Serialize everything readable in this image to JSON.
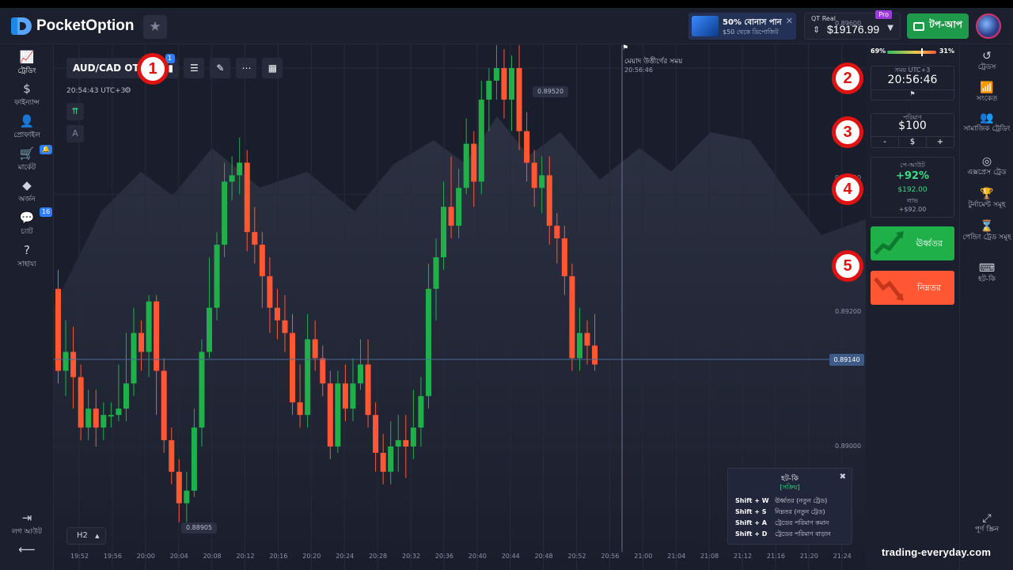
{
  "app": {
    "logo_text": "PocketOption"
  },
  "promo": {
    "line1": "50% বোনাস পান",
    "line2": "$50 থেকে ডিপোজিট"
  },
  "account": {
    "type_label": "QT Real",
    "pro_badge": "Pro",
    "balance": "$19176.99"
  },
  "topup_label": "টপ-আপ",
  "left_nav": [
    {
      "label": "ট্রেডিং",
      "icon": "chart-line-icon",
      "glyph": "📈"
    },
    {
      "label": "ফাইন্যান্স",
      "icon": "dollar-icon",
      "glyph": "$"
    },
    {
      "label": "প্রোফাইল",
      "icon": "user-icon",
      "glyph": "👤"
    },
    {
      "label": "মার্কেট",
      "icon": "cart-icon",
      "glyph": "🛒",
      "badge": "🔔"
    },
    {
      "label": "অর্জন",
      "icon": "diamond-icon",
      "glyph": "◆"
    },
    {
      "label": "চ্যাট",
      "icon": "chat-icon",
      "glyph": "💬",
      "badge": "16"
    },
    {
      "label": "সাহায্য",
      "icon": "help-icon",
      "glyph": "?"
    }
  ],
  "logout_label": "লগ আউট",
  "right_nav": [
    {
      "label": "ট্রেডস",
      "icon": "history-icon",
      "glyph": "↺"
    },
    {
      "label": "সংকেত",
      "icon": "signal-icon",
      "glyph": "📶"
    },
    {
      "label": "সামাজিক ট্রেডিং",
      "icon": "users-icon",
      "glyph": "👥"
    },
    {
      "label": "এক্সপ্রেস ট্রেড",
      "icon": "target-icon",
      "glyph": "◎"
    },
    {
      "label": "টুর্নামেন্ট সমূহ",
      "icon": "trophy-icon",
      "glyph": "🏆"
    },
    {
      "label": "পেন্ডিং ট্রেড সমূহ",
      "icon": "hourglass-icon",
      "glyph": "⌛"
    },
    {
      "label": "হট-কি",
      "icon": "keyboard-icon",
      "glyph": "⌨"
    }
  ],
  "fullscreen_label": "পূর্ণ স্ক্রিন",
  "toolbar": {
    "asset": "AUD/CAD OTC",
    "badge": "1",
    "timeframe": "H2"
  },
  "chart_meta": {
    "clock": "20:54:43 UTC+3",
    "expire_label": "মেয়াদ উত্তীর্ণের সময়",
    "expire_time": "20:56:46",
    "high_label": "0.89520",
    "low_label": "0.88905",
    "current_price": "0.89140",
    "y_axis": [
      "0.89600",
      "0.89400",
      "0.89200",
      "0.89000"
    ],
    "x_axis": [
      "19:52",
      "19:56",
      "20:00",
      "20:04",
      "20:08",
      "20:12",
      "20:16",
      "20:20",
      "20:24",
      "20:28",
      "20:32",
      "20:36",
      "20:40",
      "20:44",
      "20:48",
      "20:52",
      "20:56",
      "21:00",
      "21:04",
      "21:08",
      "21:12",
      "21:16",
      "21:20",
      "21:24"
    ]
  },
  "trade_panel": {
    "sentiment_left": "69%",
    "sentiment_right": "31%",
    "time_caption": "সময় UTC+3",
    "time_value": "20:56:46",
    "amount_caption": "পরিমাণ",
    "amount_value": "$100",
    "minus": "-",
    "currency": "$",
    "plus": "+",
    "payout_caption": "পে-আউট",
    "payout_pct": "+92%",
    "payout_amount": "$192.00",
    "profit_label": "লাভ",
    "profit_value": "+$92.00",
    "up_label": "ঊর্ধ্বতর",
    "down_label": "নিম্নতর"
  },
  "hotkeys": {
    "title": "হট-কি",
    "status": "[সক্রিয়]",
    "rows": [
      {
        "keys": "Shift + W",
        "action": "ঊর্ধ্বতর (নতুন ট্রেড)"
      },
      {
        "keys": "Shift + S",
        "action": "নিম্নতর (নতুন ট্রেড)"
      },
      {
        "keys": "Shift + A",
        "action": "ট্রেডের পরিমাণ কমান"
      },
      {
        "keys": "Shift + D",
        "action": "ট্রেডের পরিমাণ বাড়ান"
      }
    ]
  },
  "markers": [
    "1",
    "2",
    "3",
    "4",
    "5"
  ],
  "watermark": "trading-everyday.com",
  "colors": {
    "up": "#20b04a",
    "down": "#ff5733",
    "accent": "#2f7ef7"
  },
  "candles": [
    [
      0.8925,
      0.8912,
      0.8928,
      0.891
    ],
    [
      0.8912,
      0.8915,
      0.892,
      0.8908
    ],
    [
      0.8915,
      0.8911,
      0.8919,
      0.8906
    ],
    [
      0.8911,
      0.8903,
      0.8913,
      0.8901
    ],
    [
      0.8903,
      0.8906,
      0.8909,
      0.8901
    ],
    [
      0.8906,
      0.8903,
      0.8909,
      0.89
    ],
    [
      0.8903,
      0.8905,
      0.8907,
      0.8901
    ],
    [
      0.8905,
      0.8905,
      0.8907,
      0.8903
    ],
    [
      0.8905,
      0.8906,
      0.8913,
      0.8904
    ],
    [
      0.8906,
      0.891,
      0.8918,
      0.8904
    ],
    [
      0.891,
      0.8918,
      0.8922,
      0.8908
    ],
    [
      0.8918,
      0.8915,
      0.892,
      0.8912
    ],
    [
      0.8915,
      0.8923,
      0.8924,
      0.8911
    ],
    [
      0.8923,
      0.8912,
      0.8924,
      0.8905
    ],
    [
      0.8912,
      0.8901,
      0.8914,
      0.8899
    ],
    [
      0.8901,
      0.8896,
      0.8903,
      0.8894
    ],
    [
      0.8896,
      0.8891,
      0.8898,
      0.8888
    ],
    [
      0.8891,
      0.8893,
      0.8896,
      0.8888
    ],
    [
      0.8893,
      0.8903,
      0.8906,
      0.8892
    ],
    [
      0.8903,
      0.8915,
      0.8917,
      0.89
    ],
    [
      0.8915,
      0.8922,
      0.893,
      0.8914
    ],
    [
      0.8922,
      0.8932,
      0.8934,
      0.892
    ],
    [
      0.8932,
      0.8942,
      0.8945,
      0.893
    ],
    [
      0.8942,
      0.8943,
      0.8946,
      0.8939
    ],
    [
      0.8943,
      0.8945,
      0.8949,
      0.894
    ],
    [
      0.8945,
      0.8934,
      0.8947,
      0.8931
    ],
    [
      0.8934,
      0.8932,
      0.8938,
      0.8929
    ],
    [
      0.8932,
      0.8927,
      0.8934,
      0.8922
    ],
    [
      0.8927,
      0.8922,
      0.893,
      0.8918
    ],
    [
      0.8922,
      0.892,
      0.8925,
      0.8917
    ],
    [
      0.892,
      0.8918,
      0.8924,
      0.8915
    ],
    [
      0.8918,
      0.8907,
      0.8921,
      0.8905
    ],
    [
      0.8907,
      0.8905,
      0.8913,
      0.8903
    ],
    [
      0.8905,
      0.8917,
      0.8921,
      0.8903
    ],
    [
      0.8917,
      0.8914,
      0.892,
      0.8912
    ],
    [
      0.8914,
      0.891,
      0.8916,
      0.8908
    ],
    [
      0.891,
      0.89,
      0.8912,
      0.8898
    ],
    [
      0.89,
      0.891,
      0.8912,
      0.8899
    ],
    [
      0.891,
      0.8906,
      0.8913,
      0.8904
    ],
    [
      0.8906,
      0.891,
      0.8914,
      0.8904
    ],
    [
      0.891,
      0.8913,
      0.8917,
      0.8909
    ],
    [
      0.8913,
      0.8905,
      0.8917,
      0.8903
    ],
    [
      0.8905,
      0.8899,
      0.8907,
      0.8896
    ],
    [
      0.8899,
      0.8896,
      0.8902,
      0.8894
    ],
    [
      0.8896,
      0.89,
      0.8904,
      0.8894
    ],
    [
      0.89,
      0.8901,
      0.8905,
      0.8896
    ],
    [
      0.8901,
      0.89,
      0.8905,
      0.8895
    ],
    [
      0.89,
      0.8903,
      0.8909,
      0.8898
    ],
    [
      0.8903,
      0.8908,
      0.8911,
      0.89
    ],
    [
      0.8908,
      0.8925,
      0.8929,
      0.8906
    ],
    [
      0.8925,
      0.893,
      0.8933,
      0.892
    ],
    [
      0.893,
      0.8938,
      0.8942,
      0.8928
    ],
    [
      0.8938,
      0.8935,
      0.8946,
      0.8933
    ],
    [
      0.8935,
      0.8941,
      0.8944,
      0.8933
    ],
    [
      0.8941,
      0.8948,
      0.8952,
      0.894
    ],
    [
      0.8948,
      0.8942,
      0.895,
      0.8938
    ],
    [
      0.8942,
      0.8955,
      0.8958,
      0.894
    ],
    [
      0.8955,
      0.8958,
      0.896,
      0.895
    ],
    [
      0.8958,
      0.896,
      0.8964,
      0.8955
    ],
    [
      0.896,
      0.8955,
      0.8963,
      0.8952
    ],
    [
      0.8955,
      0.896,
      0.8962,
      0.895
    ],
    [
      0.896,
      0.895,
      0.8965,
      0.8947
    ],
    [
      0.895,
      0.8945,
      0.8953,
      0.8942
    ],
    [
      0.8945,
      0.8941,
      0.8947,
      0.8938
    ],
    [
      0.8941,
      0.8943,
      0.8946,
      0.8937
    ],
    [
      0.8943,
      0.8935,
      0.8946,
      0.8932
    ],
    [
      0.8935,
      0.8933,
      0.8937,
      0.8929
    ],
    [
      0.8933,
      0.8927,
      0.8935,
      0.8924
    ],
    [
      0.8927,
      0.8914,
      0.8929,
      0.8912
    ],
    [
      0.8914,
      0.8918,
      0.8922,
      0.8912
    ],
    [
      0.8918,
      0.8916,
      0.892,
      0.8913
    ],
    [
      0.8916,
      0.8913,
      0.8921,
      0.8912
    ]
  ]
}
